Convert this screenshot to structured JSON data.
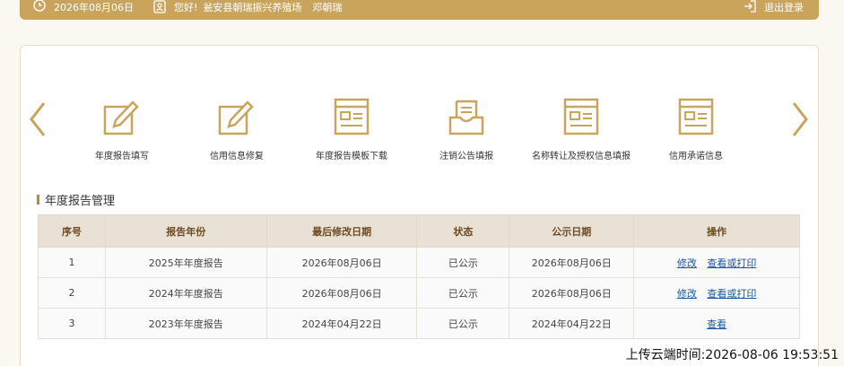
{
  "header": {
    "date": "2026年08月06日",
    "greeting": "您好!",
    "company": "瓮安县朝瑞振兴养殖场",
    "user": "邓朝瑞",
    "logout_label": "退出登录"
  },
  "functions": [
    {
      "label": "年度报告填写",
      "icon": "edit-form-icon"
    },
    {
      "label": "信用信息修复",
      "icon": "edit-form-icon"
    },
    {
      "label": "年度报告模板下载",
      "icon": "template-icon"
    },
    {
      "label": "注销公告填报",
      "icon": "inbox-icon"
    },
    {
      "label": "名称转让及授权信息填报",
      "icon": "template-icon"
    },
    {
      "label": "信用承诺信息",
      "icon": "template-icon"
    }
  ],
  "section_title": "年度报告管理",
  "table": {
    "headers": [
      "序号",
      "报告年份",
      "最后修改日期",
      "状态",
      "公示日期",
      "操作"
    ],
    "rows": [
      {
        "no": "1",
        "year": "2025年年度报告",
        "modified": "2026年08月06日",
        "status": "已公示",
        "published": "2026年08月06日",
        "edit": "修改",
        "view": "查看或打印"
      },
      {
        "no": "2",
        "year": "2024年年度报告",
        "modified": "2026年08月06日",
        "status": "已公示",
        "published": "2026年08月06日",
        "edit": "修改",
        "view": "查看或打印"
      },
      {
        "no": "3",
        "year": "2023年年度报告",
        "modified": "2024年04月22日",
        "status": "已公示",
        "published": "2024年04月22日",
        "edit": "",
        "view": "查看"
      }
    ]
  },
  "upload_time": "上传云端时间:2026-08-06 19:53:51",
  "colors": {
    "accent": "#c9a45c",
    "link": "#1a57a5",
    "header_bg": "#e9e1d6"
  }
}
